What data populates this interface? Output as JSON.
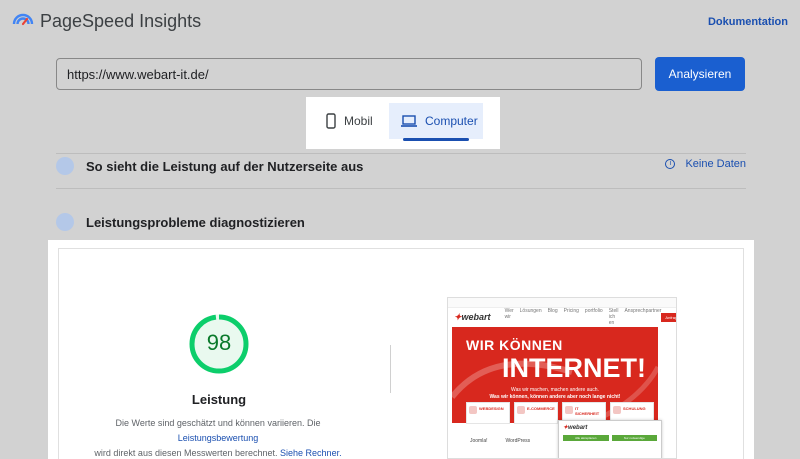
{
  "header": {
    "app_title": "PageSpeed Insights",
    "doc_link": "Dokumentation"
  },
  "search": {
    "url_value": "https://www.webart-it.de/",
    "analyze_label": "Analysieren"
  },
  "device_tabs": {
    "mobile_label": "Mobil",
    "computer_label": "Computer",
    "selected": "Computer"
  },
  "sections": {
    "user_experience_title": "So sieht die Leistung auf der Nutzerseite aus",
    "no_data_label": "Keine Daten",
    "diagnose_title": "Leistungsprobleme diagnostizieren"
  },
  "performance": {
    "score": "98",
    "score_fraction": 0.98,
    "label": "Leistung",
    "desc_part1": "Die Werte sind geschätzt und können variieren. Die ",
    "desc_link1": "Leistungsbewertung",
    "desc_part2": "wird direkt aus diesen Messwerten berechnet.",
    "desc_link2": "Siehe Rechner."
  },
  "screenshot": {
    "logo_text": "webart",
    "nav_items": [
      "Wer wir",
      "Lösungen",
      "Blog",
      "Pricing",
      "portfolio",
      "Stell ich en",
      "Ansprechpartner"
    ],
    "cta": "Anfrage",
    "hero_line1": "WIR KÖNNEN",
    "hero_line2": "INTERNET!",
    "hero_sub1": "Was wir machen, machen andere auch.",
    "hero_sub2": "Was wir können, können andere aber noch lange nicht!",
    "boxes": [
      "WEBDESIGN",
      "E-COMMERCE",
      "IT SICHERHEIT",
      "SCHULUNG"
    ],
    "cms_logos": [
      "Joomla!",
      "WordPress"
    ],
    "cookie_btn1": "Alle akzeptieren",
    "cookie_btn2": "Nur notwendige"
  },
  "colors": {
    "primary": "#1a5fd0",
    "score_green": "#0cce6b",
    "brand_red": "#d8281e"
  }
}
